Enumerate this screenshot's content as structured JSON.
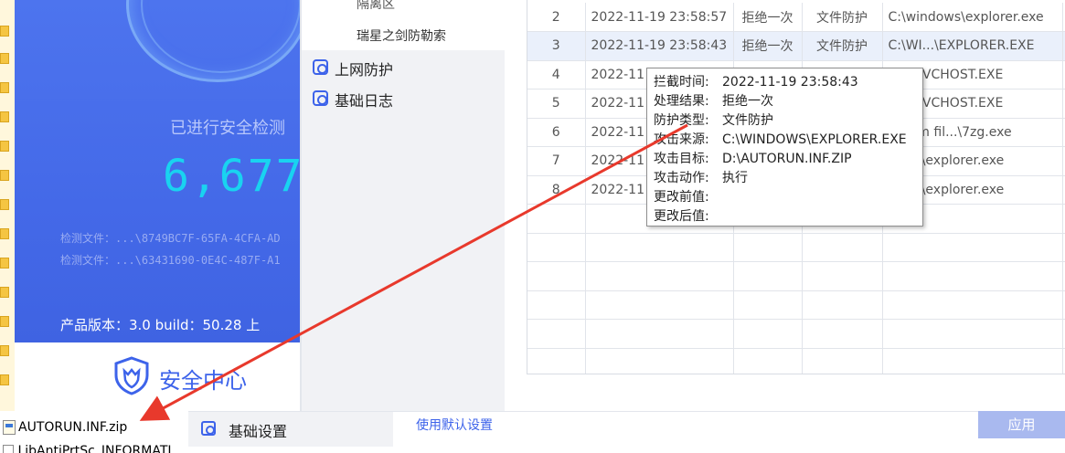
{
  "left_panel": {
    "scan_title": "已进行安全检测",
    "scan_count": "6,677",
    "scan_file_1": "检测文件：...\\8749BC7F-65FA-4CFA-AD",
    "scan_file_2": "检测文件：...\\63431690-0E4C-487F-A1",
    "version": "产品版本：3.0 build：50.28  上",
    "brand": "安全中心"
  },
  "nav": {
    "sub_item_1": "隔离区",
    "sub_item_2": "瑞星之剑防勒索",
    "items": [
      {
        "label": "上网防护",
        "icon": "globe-icon"
      },
      {
        "label": "基础日志",
        "icon": "log-icon"
      }
    ]
  },
  "log_table": {
    "rows": [
      {
        "no": "2",
        "time": "2022-11-19 23:58:57",
        "result": "拒绝一次",
        "type": "文件防护",
        "source": "C:\\windows\\explorer.exe",
        "extra": "C"
      },
      {
        "no": "3",
        "time": "2022-11-19 23:58:43",
        "result": "拒绝一次",
        "type": "文件防护",
        "source": "C:\\WI...\\EXPLORER.EXE",
        "extra": "C"
      },
      {
        "no": "4",
        "time": "2022-11",
        "result": "",
        "type": "",
        "source": "N...\\SVCHOST.EXE",
        "extra": "C"
      },
      {
        "no": "5",
        "time": "2022-11",
        "result": "",
        "type": "",
        "source": "N...\\SVCHOST.EXE",
        "extra": "C"
      },
      {
        "no": "6",
        "time": "2022-11",
        "result": "",
        "type": "",
        "source": "ogram fil...\\7zg.exe",
        "extra": "D"
      },
      {
        "no": "7",
        "time": "2022-11",
        "result": "",
        "type": "",
        "source": "dows\\explorer.exe",
        "extra": "C"
      },
      {
        "no": "8",
        "time": "2022-11",
        "result": "",
        "type": "",
        "source": "dows\\explorer.exe",
        "extra": "C"
      },
      {
        "no": "",
        "time": "",
        "result": "",
        "type": "",
        "source": "",
        "extra": ""
      },
      {
        "no": "",
        "time": "",
        "result": "",
        "type": "",
        "source": "",
        "extra": ""
      },
      {
        "no": "",
        "time": "",
        "result": "",
        "type": "",
        "source": "",
        "extra": ""
      },
      {
        "no": "",
        "time": "",
        "result": "",
        "type": "",
        "source": "",
        "extra": ""
      },
      {
        "no": "",
        "time": "",
        "result": "",
        "type": "",
        "source": "",
        "extra": ""
      },
      {
        "no": "",
        "time": "",
        "result": "",
        "type": "",
        "source": "",
        "extra": ""
      }
    ],
    "selected_row": 1
  },
  "tooltip": {
    "lines": [
      {
        "key": "拦截时间:",
        "value": "2022-11-19 23:58:43"
      },
      {
        "key": "处理结果:",
        "value": "拒绝一次"
      },
      {
        "key": "防护类型:",
        "value": "文件防护"
      },
      {
        "key": "攻击来源:",
        "value": "C:\\WINDOWS\\EXPLORER.EXE"
      },
      {
        "key": "攻击目标:",
        "value": "D:\\AUTORUN.INF.ZIP"
      },
      {
        "key": "攻击动作:",
        "value": "执行"
      },
      {
        "key": "更改前值:",
        "value": ""
      },
      {
        "key": "更改后值:",
        "value": ""
      }
    ]
  },
  "bottom": {
    "basic_settings": "基础设置",
    "default_link": "使用默认设置",
    "apply": "应用"
  },
  "files": {
    "file_1": "AUTORUN.INF.zip",
    "file_2": "LibAntiPrtSc_INFORMATI"
  },
  "colors": {
    "accent": "#3d63ea",
    "panel_blue": "#4469e8",
    "counter": "#19d3f0",
    "arrow": "#e8392c"
  }
}
